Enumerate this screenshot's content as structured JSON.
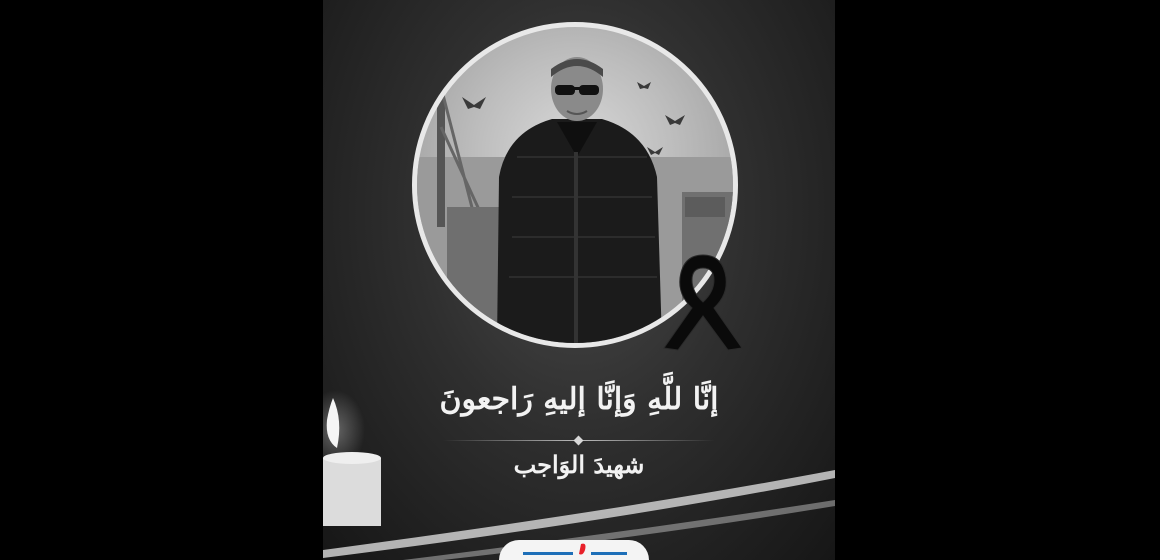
{
  "headline": "إنَّا للَّهِ وَإنَّا إليهِ رَاجعونَ",
  "subtitle": "شهيدَ الوَاجب",
  "photo": {
    "description_icon": "portrait-photo"
  },
  "ribbon": {
    "icon": "mourning-ribbon-icon",
    "color": "#0a0a0a"
  },
  "candle": {
    "icon": "candle-icon"
  },
  "logo": {
    "icon": "brand-logo-icon",
    "accent": "#e8202a",
    "secondary": "#1e6fb8"
  },
  "colors": {
    "background": "#000000",
    "poster": "#2f2f2f",
    "text": "#f2f2f2"
  }
}
